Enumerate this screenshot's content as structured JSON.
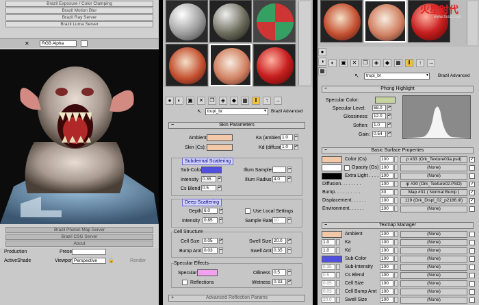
{
  "panel1": {
    "top_bars": [
      "Brazil Exposure / Color Clamping",
      "Brazil Motion Blur",
      "Brazil Ray Server",
      "Brazil Luma Server"
    ],
    "channel": "RGB Alpha",
    "bottom_bars": [
      "Brazil Photon Map Server",
      "Brazil CSG Server",
      "About"
    ],
    "production_label": "Production",
    "preset_label": "Preset:",
    "viewport_label": "Viewport:",
    "viewport_value": "Perspective",
    "activeshade_label": "ActiveShade",
    "render_label": "Render"
  },
  "panel2": {
    "material_name": "trupi_br",
    "material_type": "Brazil Advanced",
    "skin_header": "Skin Parameters",
    "ambient_label": "Ambient",
    "skin_label": "Skin (Cs):",
    "ka_label": "Ka (ambient)",
    "ka_value": "1.0",
    "kd_label": "Kd (diffuse)",
    "kd_value": "1.0",
    "subdermal_header": "Subdermal Scattering",
    "subcolor_label": "Sub-Color",
    "intensity_label": "Intensity",
    "intensity_value": "0.35",
    "csblend_label": "Cs Blend",
    "csblend_value": "0.5",
    "illum_samples_label": "Illum Samples",
    "illum_samples_value": "",
    "illum_radius_label": "Illum Radius",
    "illum_radius_value": "4.0",
    "deep_header": "Deep Scattering",
    "depth_label": "Depth",
    "depth_value": "6.0",
    "deep_intensity_label": "Intensity",
    "deep_intensity_value": "0.85",
    "use_local_label": "Use Local Settings",
    "sample_rate_label": "Sample Rate",
    "sample_rate_value": "10",
    "cell_header": "Cell Structure",
    "cell_size_label": "Cell Size",
    "cell_size_value": "0.05",
    "bump_amt_label": "Bump Amt",
    "bump_amt_value": "0.03",
    "swell_size_label": "Swell Size",
    "swell_size_value": "20.0",
    "swell_amt_label": "Swell Amt",
    "swell_amt_value": "0.35",
    "spec_header": "Specular Effects",
    "specular_label": "Specular",
    "reflections_label": "Reflections",
    "oiliness_label": "Oiliness",
    "oiliness_value": "0.5",
    "wetness_label": "Wetness",
    "wetness_value": "0.33",
    "adv_refl_label": "Advanced Reflection Params"
  },
  "panel3": {
    "material_name": "trupi_br",
    "material_type": "Brazil Advanced",
    "watermark": "火星时代",
    "watermark_url": "www.hxsd.com",
    "phong_header": "Phong Highlight",
    "spec_color_label": "Specular Color:",
    "spec_level_label": "Specular Level:",
    "spec_level_value": "68.0",
    "glossiness_label": "Glossiness:",
    "glossiness_value": "12.0",
    "soften_label": "Soften:",
    "soften_value": "1.0",
    "gain_label": "Gain:",
    "gain_value": "0.54",
    "basic_header": "Basic Surface Properties",
    "basic_rows": [
      {
        "label": "Color (Cs)",
        "amount": "100",
        "map": "p #33 (Ork_Texture03a.psd)",
        "checked": true
      },
      {
        "label": "Opacity (Os)",
        "amount": "100",
        "map": "(None)",
        "checked": false
      },
      {
        "label": "Extra Light . . . . . .",
        "amount": "100",
        "map": "(None)",
        "checked": false
      },
      {
        "label": "Diffusion. . . . . . . .",
        "amount": "100",
        "map": "ip #30 (Ork_Texture02.PSD)",
        "checked": true
      },
      {
        "label": "Bump. . . . . . . . . .",
        "amount": "30",
        "map": "Map #31  ( Normal Bump )",
        "checked": true
      },
      {
        "label": "Displacement. . . . . .",
        "amount": "100",
        "map": "119 (Ork_Displ_02_p2186.tif)",
        "checked": true
      },
      {
        "label": "Environment. . . . . .",
        "amount": "100",
        "map": "(None)",
        "checked": false
      }
    ],
    "texmap_header": "Texmap Manager",
    "tex_rows": [
      {
        "label": "Ambient",
        "value": "",
        "amount": "100",
        "map": "(None)"
      },
      {
        "label": "Ka",
        "value": "1.0",
        "amount": "100",
        "map": "(None)"
      },
      {
        "label": "Kd",
        "value": "1.0",
        "amount": "100",
        "map": "(None)"
      },
      {
        "label": "Sub-Color",
        "value": "",
        "amount": "100",
        "map": "(None)"
      },
      {
        "label": "Sub-Intensity",
        "value": "0.35",
        "amount": "100",
        "map": "(None)"
      },
      {
        "label": "Cs Blend",
        "value": "0.5",
        "amount": "100",
        "map": "(None)"
      },
      {
        "label": "Cell Size",
        "value": "0.05",
        "amount": "100",
        "map": "(None)"
      },
      {
        "label": "Cell Bump Amt",
        "value": "0.03",
        "amount": "100",
        "map": "(None)"
      },
      {
        "label": "Swell Size",
        "value": "20.0",
        "amount": "100",
        "map": "(None)"
      }
    ]
  },
  "colors": {
    "ambient": "#f2c8a8",
    "skin": "#f2c8a8",
    "subcolor": "#5050e0",
    "specular": "#f2a0f0",
    "spec_color": "#c8d4a0",
    "extra_light": "#000000",
    "opacity": "#ffffff"
  },
  "icons": [
    "sphere-preview-icon",
    "pick-material-icon",
    "put-to-scene-icon",
    "delete-icon",
    "copy-icon",
    "material-id-icon",
    "show-map-icon",
    "go-parent-icon",
    "go-sibling-icon"
  ]
}
